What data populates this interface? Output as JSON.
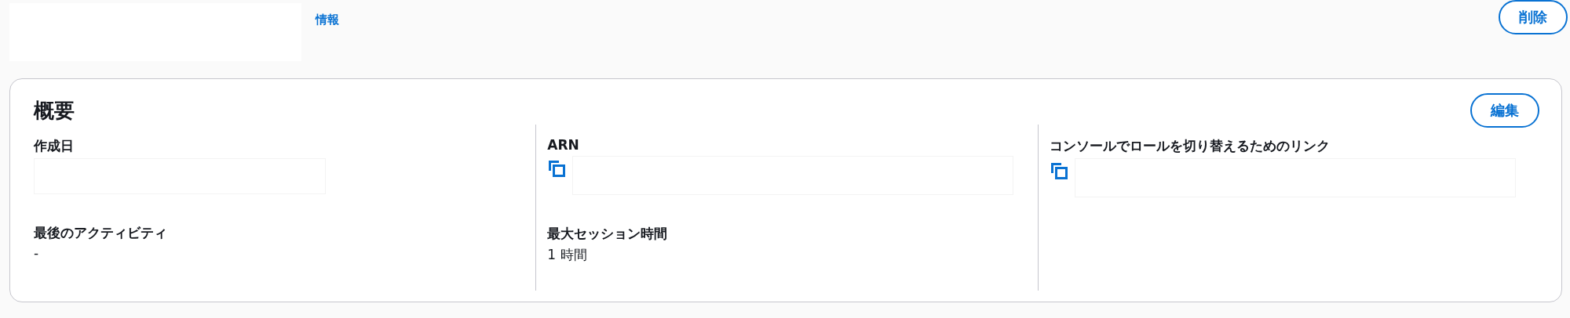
{
  "header": {
    "info_link": "情報",
    "delete_button": "削除"
  },
  "summary": {
    "title": "概要",
    "edit_button": "編集",
    "columns": [
      {
        "fields": [
          {
            "label": "作成日",
            "kind": "redacted"
          },
          {
            "label": "最後のアクティビティ",
            "kind": "text",
            "value": "-"
          }
        ]
      },
      {
        "fields": [
          {
            "label": "ARN",
            "kind": "copy"
          },
          {
            "label": "最大セッション時間",
            "kind": "text",
            "value": "1 時間"
          }
        ]
      },
      {
        "fields": [
          {
            "label": "コンソールでロールを切り替えるためのリンク",
            "kind": "copy"
          }
        ]
      }
    ]
  }
}
